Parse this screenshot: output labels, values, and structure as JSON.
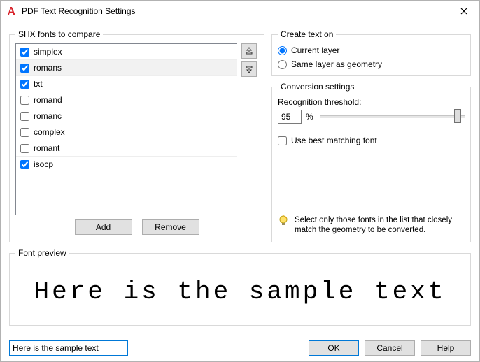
{
  "window": {
    "title": "PDF Text Recognition Settings"
  },
  "shx": {
    "legend": "SHX fonts to compare",
    "fonts": [
      {
        "name": "simplex",
        "checked": true
      },
      {
        "name": "romans",
        "checked": true
      },
      {
        "name": "txt",
        "checked": true
      },
      {
        "name": "romand",
        "checked": false
      },
      {
        "name": "romanc",
        "checked": false
      },
      {
        "name": "complex",
        "checked": false
      },
      {
        "name": "romant",
        "checked": false
      },
      {
        "name": "isocp",
        "checked": true
      }
    ],
    "add": "Add",
    "remove": "Remove"
  },
  "createTextOn": {
    "legend": "Create text on",
    "options": {
      "current": "Current layer",
      "sameLayer": "Same layer as geometry"
    },
    "selected": "current"
  },
  "conversion": {
    "legend": "Conversion settings",
    "thresholdLabel": "Recognition threshold:",
    "threshold": "95",
    "percent": "%",
    "useBestFont": "Use best matching font",
    "useBestFontChecked": false,
    "hint": "Select only those fonts in the list that closely match the geometry to be converted."
  },
  "preview": {
    "legend": "Font preview",
    "text": "Here is the sample text"
  },
  "sampleInput": "Here is the sample text",
  "buttons": {
    "ok": "OK",
    "cancel": "Cancel",
    "help": "Help"
  }
}
